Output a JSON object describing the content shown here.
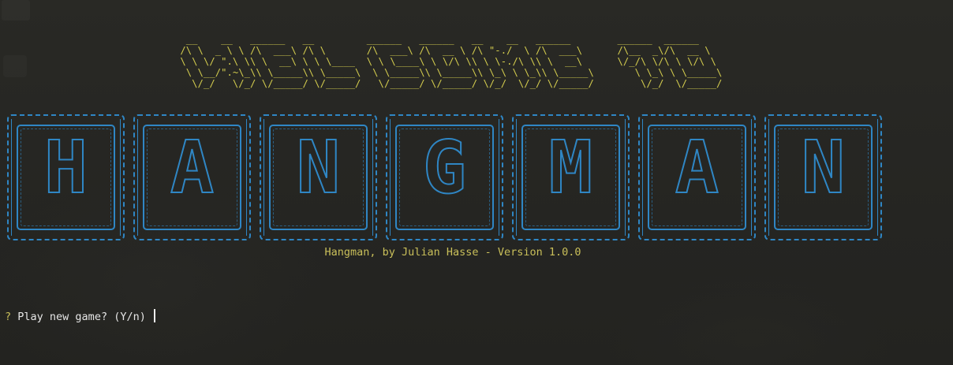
{
  "terminal": {
    "welcome_art": "  __    __   ______   __         ______   ______   __    __   ______        ______  ______\n /\\ \\  _ \\ \\ /\\  ___\\ /\\ \\       /\\  ___\\ /\\  __ \\ /\\ \"-./  \\ /\\  ___\\      /\\__  _\\/\\  __ \\\n \\ \\ \\/ \".\\ \\\\ \\  __\\ \\ \\ \\____  \\ \\ \\____\\ \\ \\/\\ \\\\ \\ \\-./\\ \\\\ \\  __\\      \\/_/\\ \\/\\ \\ \\/\\ \\\n  \\ \\__/\".~\\_\\\\ \\_____\\\\ \\_____\\  \\ \\_____\\\\ \\_____\\\\ \\_\\ \\ \\_\\\\ \\_____\\       \\ \\_\\ \\ \\_____\\\n   \\/_/   \\/_/ \\/_____/ \\/_____/   \\/_____/ \\/_____/ \\/_/  \\/_/ \\/_____/        \\/_/  \\/_____/",
    "title_letters": [
      "H",
      "A",
      "N",
      "G",
      "M",
      "A",
      "N"
    ],
    "credit_line": "Hangman, by Julian Hasse - Version 1.0.0",
    "prompt_symbol": "?",
    "prompt_text": "Play new game? (Y/n)",
    "colors": {
      "welcome": "#d4cd4e",
      "tiles": "#2f86c4",
      "credit": "#c9bf5a",
      "prompt": "#e6e6e6",
      "background": "#262623"
    }
  }
}
